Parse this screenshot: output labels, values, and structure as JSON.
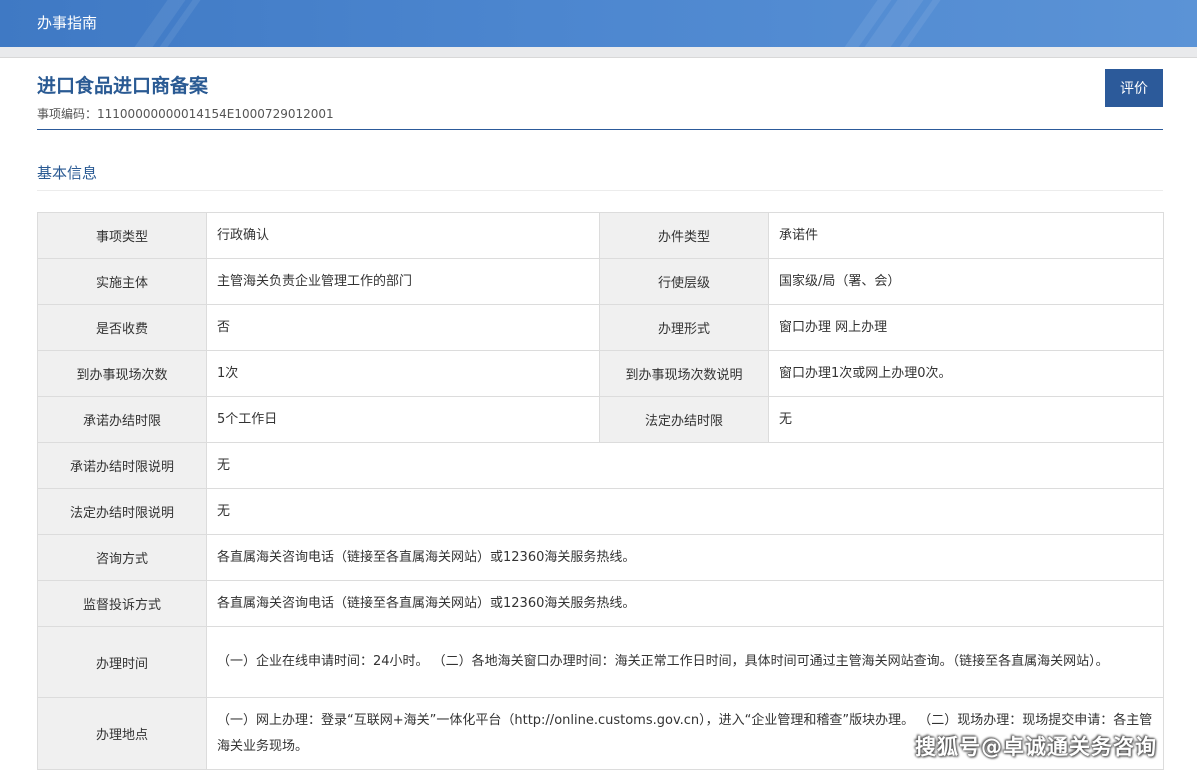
{
  "header": {
    "title": "办事指南"
  },
  "item": {
    "title": "进口食品进口商备案",
    "code_label": "事项编码：",
    "code": "11100000000014154E1000729012001",
    "rate_button": "评价"
  },
  "section": {
    "title": "基本信息"
  },
  "rows": [
    {
      "k1": "事项类型",
      "v1": "行政确认",
      "k2": "办件类型",
      "v2": "承诺件"
    },
    {
      "k1": "实施主体",
      "v1": "主管海关负责企业管理工作的部门",
      "k2": "行使层级",
      "v2": "国家级/局（署、会）"
    },
    {
      "k1": "是否收费",
      "v1": "否",
      "k2": "办理形式",
      "v2": "窗口办理 网上办理"
    },
    {
      "k1": "到办事现场次数",
      "v1": "1次",
      "k2": "到办事现场次数说明",
      "v2": "窗口办理1次或网上办理0次。"
    },
    {
      "k1": "承诺办结时限",
      "v1": "5个工作日",
      "k2": "法定办结时限",
      "v2": "无"
    }
  ],
  "wide_rows": [
    {
      "k": "承诺办结时限说明",
      "v": "无"
    },
    {
      "k": "法定办结时限说明",
      "v": "无"
    },
    {
      "k": "咨询方式",
      "v": "各直属海关咨询电话（链接至各直属海关网站）或12360海关服务热线。"
    },
    {
      "k": "监督投诉方式",
      "v": "各直属海关咨询电话（链接至各直属海关网站）或12360海关服务热线。"
    },
    {
      "k": "办理时间",
      "v": "（一）企业在线申请时间：24小时。 （二）各地海关窗口办理时间：海关正常工作日时间，具体时间可通过主管海关网站查询。（链接至各直属海关网站）。"
    },
    {
      "k": "办理地点",
      "v": "（一）网上办理：登录“互联网+海关”一体化平台（http://online.customs.gov.cn），进入“企业管理和稽查”版块办理。 （二）现场办理：现场提交申请：各主管海关业务现场。"
    }
  ],
  "watermark": "搜狐号@卓诚通关务咨询"
}
